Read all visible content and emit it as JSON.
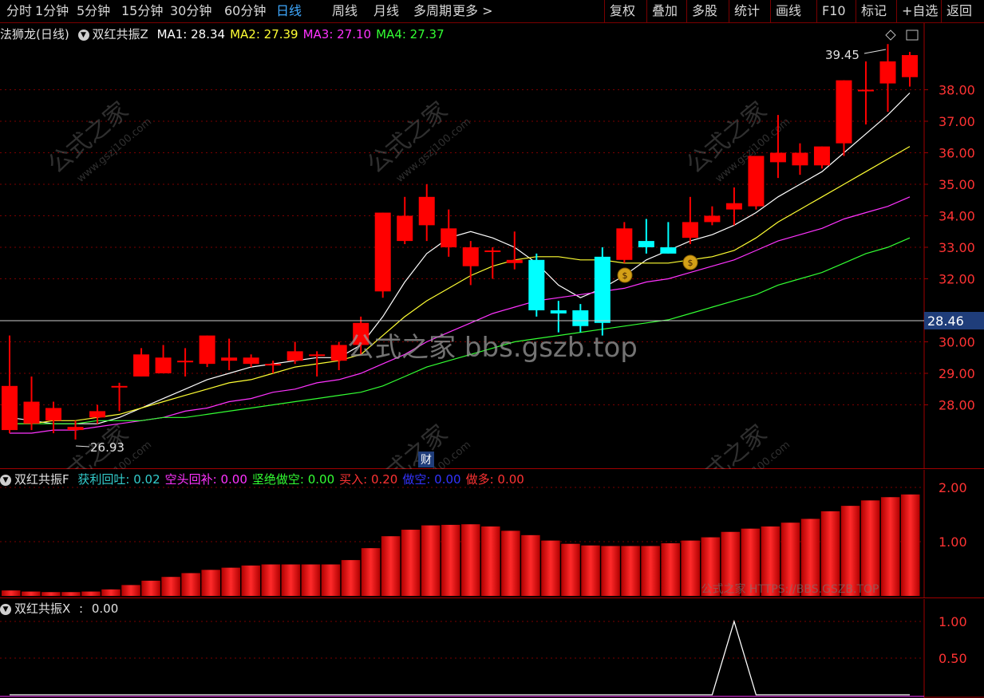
{
  "toolbar": {
    "periods": [
      "分时",
      "1分钟",
      "5分钟",
      "15分钟",
      "30分钟",
      "60分钟",
      "日线",
      "周线",
      "月线",
      "多周期",
      "更多 >"
    ],
    "active_period": "日线",
    "actions": [
      "复权",
      "叠加",
      "多股",
      "统计",
      "画线",
      "F10",
      "标记",
      "+自选",
      "返回"
    ]
  },
  "main_panel": {
    "title": "法狮龙(日线)",
    "indicator": "双红共振Z",
    "ma_labels": [
      {
        "name": "MA1",
        "value": "28.34",
        "color": "#ffffff"
      },
      {
        "name": "MA2",
        "value": "27.39",
        "color": "#ffff33"
      },
      {
        "name": "MA3",
        "value": "27.10",
        "color": "#ff33ff"
      },
      {
        "name": "MA4",
        "value": "27.37",
        "color": "#33ff33"
      }
    ],
    "price_axis": [
      "38.00",
      "37.00",
      "36.00",
      "35.00",
      "34.00",
      "33.00",
      "32.00",
      "30.00",
      "29.00",
      "28.00"
    ],
    "current_price": "28.46",
    "high_label": "39.45",
    "low_label": "26.93",
    "cai_marker": "财",
    "watermark_center": "公式之家 bbs.gszb.top",
    "watermark_corner": "公式之家",
    "watermark_url": "www.gszj100.com"
  },
  "panel2": {
    "indicator": "双红共振F",
    "labels": [
      {
        "name": "获利回吐",
        "value": "0.02",
        "color": "#33cccc"
      },
      {
        "name": "空头回补",
        "value": "0.00",
        "color": "#ff33ff"
      },
      {
        "name": "坚绝做空",
        "value": "0.00",
        "color": "#33ff33"
      },
      {
        "name": "买入",
        "value": "0.20",
        "color": "#ff3333"
      },
      {
        "name": "做空",
        "value": "0.00",
        "color": "#3333ff"
      },
      {
        "name": "做多",
        "value": "0.00",
        "color": "#ff3333"
      }
    ],
    "axis": [
      "2.00",
      "1.00"
    ],
    "watermark": "公式之家 HTTPS://BBS.GSZB.TOP"
  },
  "panel3": {
    "indicator": "双红共振X",
    "value": "0.00",
    "axis": [
      "1.00",
      "0.50"
    ]
  },
  "chart_data": {
    "type": "candlestick",
    "candles": [
      {
        "o": 28.6,
        "c": 27.2,
        "h": 30.2,
        "l": 27.1
      },
      {
        "o": 28.1,
        "c": 27.4,
        "h": 28.9,
        "l": 27.2
      },
      {
        "o": 27.9,
        "c": 27.5,
        "h": 28.1,
        "l": 27.1
      },
      {
        "o": 27.2,
        "c": 27.3,
        "h": 27.5,
        "l": 26.9
      },
      {
        "o": 27.8,
        "c": 27.6,
        "h": 28.0,
        "l": 27.4
      },
      {
        "o": 28.6,
        "c": 28.6,
        "h": 28.7,
        "l": 27.8
      },
      {
        "o": 29.6,
        "c": 28.9,
        "h": 29.8,
        "l": 28.9
      },
      {
        "o": 29.5,
        "c": 29.0,
        "h": 29.9,
        "l": 29.0
      },
      {
        "o": 29.4,
        "c": 29.4,
        "h": 29.8,
        "l": 28.9
      },
      {
        "o": 30.2,
        "c": 29.3,
        "h": 30.2,
        "l": 29.2
      },
      {
        "o": 29.5,
        "c": 29.4,
        "h": 30.1,
        "l": 29.1
      },
      {
        "o": 29.5,
        "c": 29.3,
        "h": 29.6,
        "l": 29.2
      },
      {
        "o": 29.3,
        "c": 29.3,
        "h": 29.4,
        "l": 29.0
      },
      {
        "o": 29.7,
        "c": 29.4,
        "h": 30.0,
        "l": 29.3
      },
      {
        "o": 29.6,
        "c": 29.6,
        "h": 29.7,
        "l": 28.9
      },
      {
        "o": 29.9,
        "c": 29.4,
        "h": 30.0,
        "l": 29.1
      },
      {
        "o": 30.6,
        "c": 29.9,
        "h": 30.8,
        "l": 29.6
      },
      {
        "o": 34.1,
        "c": 31.6,
        "h": 34.1,
        "l": 31.4
      },
      {
        "o": 34.0,
        "c": 33.2,
        "h": 34.6,
        "l": 33.1
      },
      {
        "o": 34.6,
        "c": 33.7,
        "h": 35.0,
        "l": 33.2
      },
      {
        "o": 33.6,
        "c": 33.0,
        "h": 34.2,
        "l": 32.7
      },
      {
        "o": 33.0,
        "c": 32.4,
        "h": 33.2,
        "l": 31.8
      },
      {
        "o": 32.9,
        "c": 32.9,
        "h": 33.0,
        "l": 32.0
      },
      {
        "o": 32.6,
        "c": 32.5,
        "h": 33.5,
        "l": 32.3
      },
      {
        "o": 32.6,
        "c": 31.0,
        "h": 32.8,
        "l": 30.8
      },
      {
        "o": 30.9,
        "c": 31.0,
        "h": 31.3,
        "l": 30.3
      },
      {
        "o": 30.5,
        "c": 31.0,
        "h": 31.2,
        "l": 30.3
      },
      {
        "o": 30.6,
        "c": 32.7,
        "h": 33.0,
        "l": 30.2
      },
      {
        "o": 33.6,
        "c": 32.6,
        "h": 33.8,
        "l": 32.5
      },
      {
        "o": 33.2,
        "c": 33.0,
        "h": 33.9,
        "l": 32.8
      },
      {
        "o": 33.0,
        "c": 32.8,
        "h": 33.8,
        "l": 32.8
      },
      {
        "o": 33.3,
        "c": 33.8,
        "h": 34.6,
        "l": 33.1
      },
      {
        "o": 34.0,
        "c": 33.8,
        "h": 34.3,
        "l": 33.7
      },
      {
        "o": 34.4,
        "c": 34.2,
        "h": 34.9,
        "l": 33.7
      },
      {
        "o": 35.9,
        "c": 34.3,
        "h": 35.9,
        "l": 34.2
      },
      {
        "o": 36.0,
        "c": 35.7,
        "h": 37.2,
        "l": 35.2
      },
      {
        "o": 36.0,
        "c": 35.6,
        "h": 36.3,
        "l": 35.3
      },
      {
        "o": 36.2,
        "c": 35.6,
        "h": 36.2,
        "l": 35.5
      },
      {
        "o": 38.3,
        "c": 36.3,
        "h": 38.3,
        "l": 35.9
      },
      {
        "o": 38.0,
        "c": 38.0,
        "h": 38.9,
        "l": 36.9
      },
      {
        "o": 38.9,
        "c": 38.2,
        "h": 39.45,
        "l": 37.3
      },
      {
        "o": 39.1,
        "c": 38.4,
        "h": 39.2,
        "l": 38.1
      }
    ],
    "ma1": [
      27.6,
      27.5,
      27.4,
      27.4,
      27.4,
      27.6,
      27.9,
      28.2,
      28.5,
      28.8,
      29.0,
      29.2,
      29.3,
      29.4,
      29.5,
      29.5,
      29.9,
      30.8,
      31.9,
      32.8,
      33.3,
      33.5,
      33.3,
      33.0,
      32.5,
      31.8,
      31.4,
      31.7,
      32.1,
      32.6,
      32.9,
      33.2,
      33.4,
      33.7,
      34.1,
      34.6,
      35.0,
      35.4,
      36.0,
      36.6,
      37.2,
      37.9
    ],
    "ma2": [
      27.4,
      27.4,
      27.5,
      27.5,
      27.6,
      27.7,
      27.9,
      28.1,
      28.3,
      28.5,
      28.7,
      28.8,
      29.0,
      29.2,
      29.3,
      29.4,
      29.6,
      30.2,
      30.8,
      31.3,
      31.7,
      32.1,
      32.4,
      32.6,
      32.7,
      32.7,
      32.6,
      32.6,
      32.5,
      32.5,
      32.5,
      32.6,
      32.7,
      32.9,
      33.3,
      33.8,
      34.2,
      34.6,
      35.0,
      35.4,
      35.8,
      36.2
    ],
    "ma3": [
      27.1,
      27.1,
      27.2,
      27.2,
      27.3,
      27.4,
      27.5,
      27.6,
      27.8,
      27.9,
      28.1,
      28.2,
      28.4,
      28.5,
      28.7,
      28.8,
      29.0,
      29.3,
      29.6,
      30.0,
      30.3,
      30.6,
      30.9,
      31.1,
      31.3,
      31.4,
      31.5,
      31.6,
      31.7,
      31.9,
      32.0,
      32.2,
      32.4,
      32.6,
      32.9,
      33.2,
      33.4,
      33.6,
      33.9,
      34.1,
      34.3,
      34.6
    ],
    "ma4": [
      27.4,
      27.4,
      27.4,
      27.4,
      27.5,
      27.5,
      27.5,
      27.6,
      27.6,
      27.7,
      27.8,
      27.9,
      28.0,
      28.1,
      28.2,
      28.3,
      28.4,
      28.6,
      28.9,
      29.2,
      29.4,
      29.6,
      29.8,
      30.0,
      30.1,
      30.2,
      30.3,
      30.4,
      30.5,
      30.6,
      30.7,
      30.9,
      31.1,
      31.3,
      31.5,
      31.8,
      32.0,
      32.2,
      32.5,
      32.8,
      33.0,
      33.3
    ],
    "panel2_bars": [
      0.1,
      0.08,
      0.07,
      0.07,
      0.08,
      0.12,
      0.2,
      0.28,
      0.35,
      0.42,
      0.48,
      0.52,
      0.56,
      0.58,
      0.58,
      0.58,
      0.58,
      0.66,
      0.88,
      1.1,
      1.22,
      1.3,
      1.31,
      1.32,
      1.28,
      1.2,
      1.12,
      1.02,
      0.96,
      0.93,
      0.92,
      0.92,
      0.92,
      0.97,
      1.02,
      1.08,
      1.18,
      1.24,
      1.28,
      1.35,
      1.42,
      1.56,
      1.66,
      1.76,
      1.82,
      1.87
    ],
    "panel2_green_top": [
      0,
      0,
      0,
      0,
      0,
      0,
      0,
      0,
      0,
      0,
      0,
      0,
      0,
      0,
      0,
      0,
      0,
      0,
      0,
      0,
      0,
      0,
      0,
      0,
      1.25,
      1.18,
      1.08,
      0.98,
      0.95,
      0,
      0,
      0,
      0,
      0,
      0,
      0,
      0,
      0,
      0,
      0,
      0,
      0,
      0,
      0,
      0,
      0
    ],
    "panel3_line": [
      0,
      0,
      0,
      0,
      0,
      0,
      0,
      0,
      0,
      0,
      0,
      0,
      0,
      0,
      0,
      0,
      0,
      0,
      0,
      0,
      0,
      0,
      0,
      0,
      0,
      0,
      0,
      0,
      0,
      0,
      0,
      0,
      0,
      1.0,
      0,
      0,
      0,
      0,
      0,
      0,
      0,
      0
    ]
  }
}
